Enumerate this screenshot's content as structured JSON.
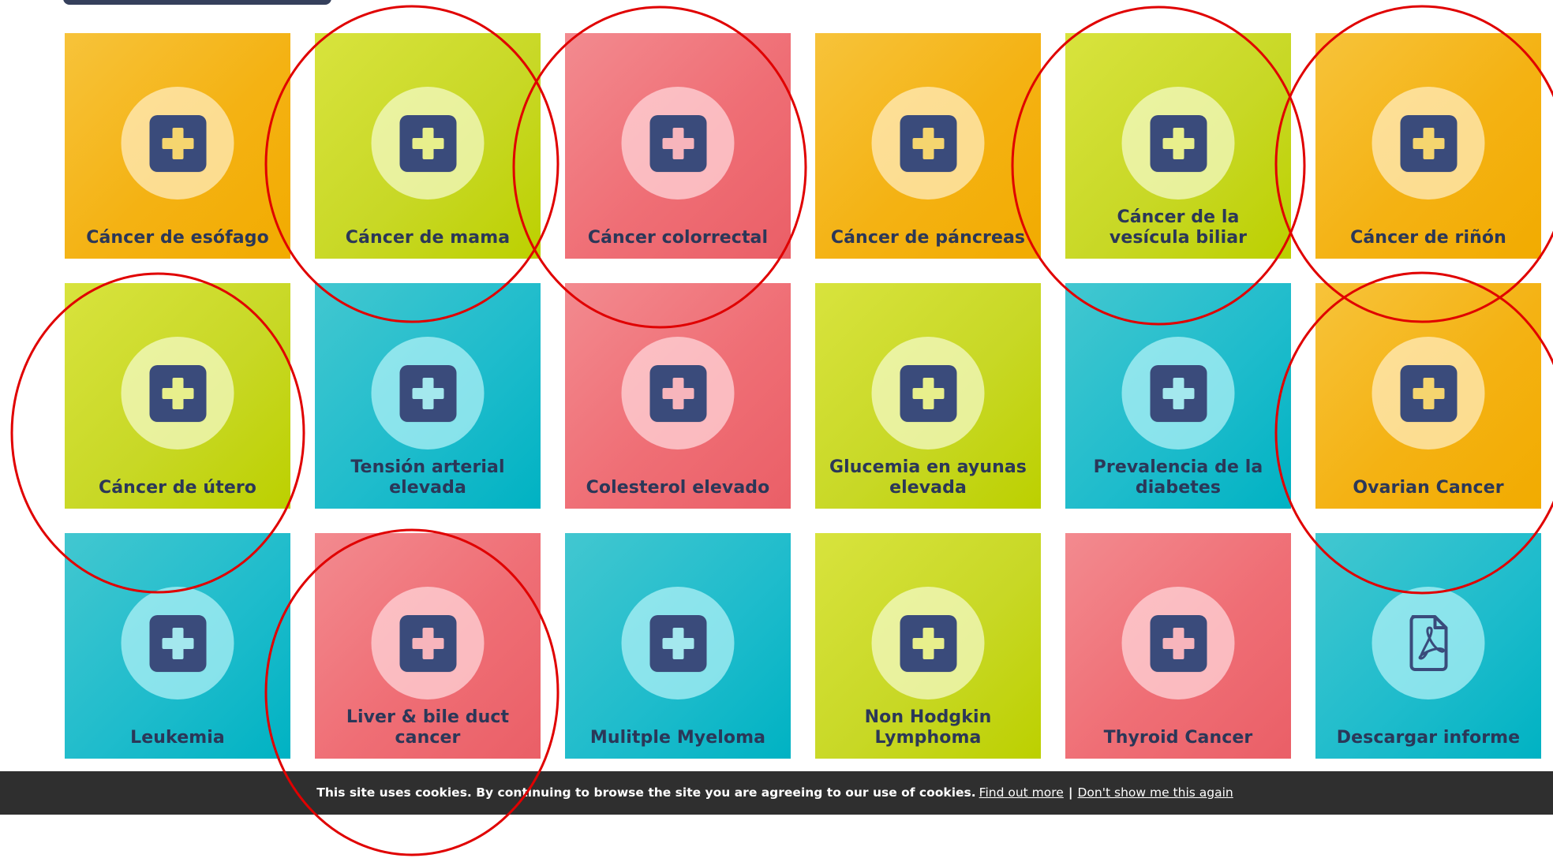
{
  "tiles": [
    {
      "label": "Cáncer de esófago",
      "color": "orange",
      "icon": "medical-plus-icon"
    },
    {
      "label": "Cáncer de mama",
      "color": "lime",
      "icon": "medical-plus-icon"
    },
    {
      "label": "Cáncer colorrectal",
      "color": "coral",
      "icon": "medical-plus-icon"
    },
    {
      "label": "Cáncer de páncreas",
      "color": "orange",
      "icon": "medical-plus-icon"
    },
    {
      "label": "Cáncer de la vesícula biliar",
      "color": "lime",
      "icon": "medical-plus-icon"
    },
    {
      "label": "Cáncer de riñón",
      "color": "orange",
      "icon": "medical-plus-icon"
    },
    {
      "label": "Cáncer de útero",
      "color": "lime",
      "icon": "medical-plus-icon"
    },
    {
      "label": "Tensión arterial elevada",
      "color": "teal",
      "icon": "medical-plus-icon"
    },
    {
      "label": "Colesterol elevado",
      "color": "coral",
      "icon": "medical-plus-icon"
    },
    {
      "label": "Glucemia en ayunas elevada",
      "color": "lime",
      "icon": "medical-plus-icon"
    },
    {
      "label": "Prevalencia de la diabetes",
      "color": "teal",
      "icon": "medical-plus-icon"
    },
    {
      "label": "Ovarian Cancer",
      "color": "orange",
      "icon": "medical-plus-icon"
    },
    {
      "label": "Leukemia",
      "color": "teal",
      "icon": "medical-plus-icon"
    },
    {
      "label": "Liver & bile duct cancer",
      "color": "coral",
      "icon": "medical-plus-icon"
    },
    {
      "label": "Mulitple Myeloma",
      "color": "teal",
      "icon": "medical-plus-icon"
    },
    {
      "label": "Non Hodgkin Lymphoma",
      "color": "lime",
      "icon": "medical-plus-icon"
    },
    {
      "label": "Thyroid Cancer",
      "color": "coral",
      "icon": "medical-plus-icon"
    },
    {
      "label": "Descargar informe",
      "color": "teal",
      "icon": "pdf-file-icon"
    }
  ],
  "cookie_bar": {
    "text": "This site uses cookies. By continuing to browse the site you are agreeing to our use of cookies.",
    "find_out_more": "Find out more",
    "separator": "|",
    "dont_show": "Don't show me this again"
  },
  "colors": {
    "orange": "#f4b213",
    "lime": "#c8d826",
    "coral": "#ef6e75",
    "teal": "#1fbccc",
    "label_text": "#2b3758",
    "icon_box": "#3a4b7b",
    "cookie_bar_bg": "#2f2f2f",
    "annotation_circle": "#e00000"
  },
  "annotations": {
    "circled_items": [
      "Cáncer de mama",
      "Cáncer colorrectal",
      "Cáncer de la vesícula biliar",
      "Cáncer de riñón",
      "Cáncer de útero",
      "Ovarian Cancer",
      "Liver & bile duct cancer"
    ]
  }
}
